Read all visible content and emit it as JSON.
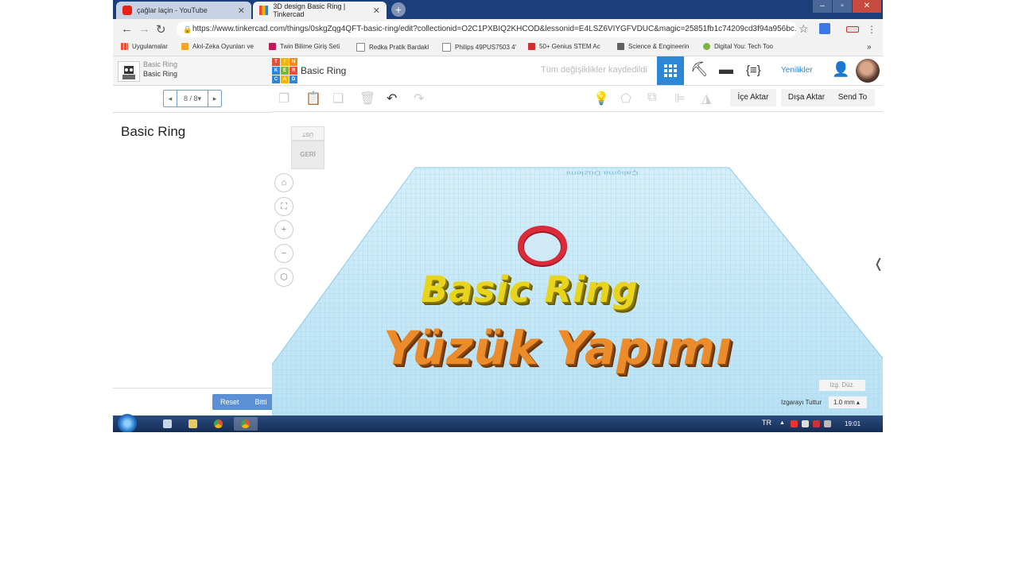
{
  "browser": {
    "tabs": [
      {
        "title": "çağlar laçin - YouTube",
        "favicon": "youtube-icon"
      },
      {
        "title": "3D design Basic Ring | Tinkercad",
        "favicon": "tinkercad-icon"
      }
    ],
    "url": "https://www.tinkercad.com/things/0skgZqg4QFT-basic-ring/edit?collectionid=O2C1PXBIQ2KHCOD&lessonid=E4LSZ6VIYGFVDUC&magic=25851fb1c74209cd3f94a956bc...",
    "bookmarks": [
      "Uygulamalar",
      "Akıl-Zeka Oyunları ve",
      "Twin Bilime Giriş Seti",
      "Redka Pratik Bardakl",
      "Philips 49PUS7503 4'",
      "50+ Genius STEM Ac",
      "Science & Engineerin",
      "Digital You: Tech Too"
    ]
  },
  "lesson": {
    "breadcrumb_top": "Basic Ring",
    "breadcrumb_bottom": "Basic Ring",
    "pager": "8 / 8",
    "title": "Basic Ring",
    "reset_label": "Reset",
    "done_label": "Bitti"
  },
  "header": {
    "logo_letters": [
      "T",
      "I",
      "N",
      "K",
      "E",
      "R",
      "C",
      "A",
      "D"
    ],
    "design_name": "Basic Ring",
    "save_status": "Tüm değişiklikler kaydedildi",
    "news_label": "Yenilikler"
  },
  "toolbar": {
    "import_label": "İçe Aktar",
    "export_label": "Dışa Aktar",
    "send_label": "Send To"
  },
  "viewport": {
    "viewcube_top": "ÜST",
    "viewcube_front": "GERİ",
    "workplane_label": "Çalışma Düzlemi",
    "edit_grid_label": "Izg. Düz.",
    "snap_label": "Izgarayı Tuttur",
    "snap_value": "1.0 mm",
    "overlay_title1": "Basic Ring",
    "overlay_title2": "Yüzük Yapımı"
  },
  "taskbar": {
    "language": "TR",
    "clock": "19:01"
  },
  "colors": {
    "accent": "#2e86d6",
    "grid_blue": "#bfe3f5",
    "ring_red": "#d92b3a",
    "title_yellow": "#e8d41a",
    "title_orange": "#ec8b2a"
  }
}
